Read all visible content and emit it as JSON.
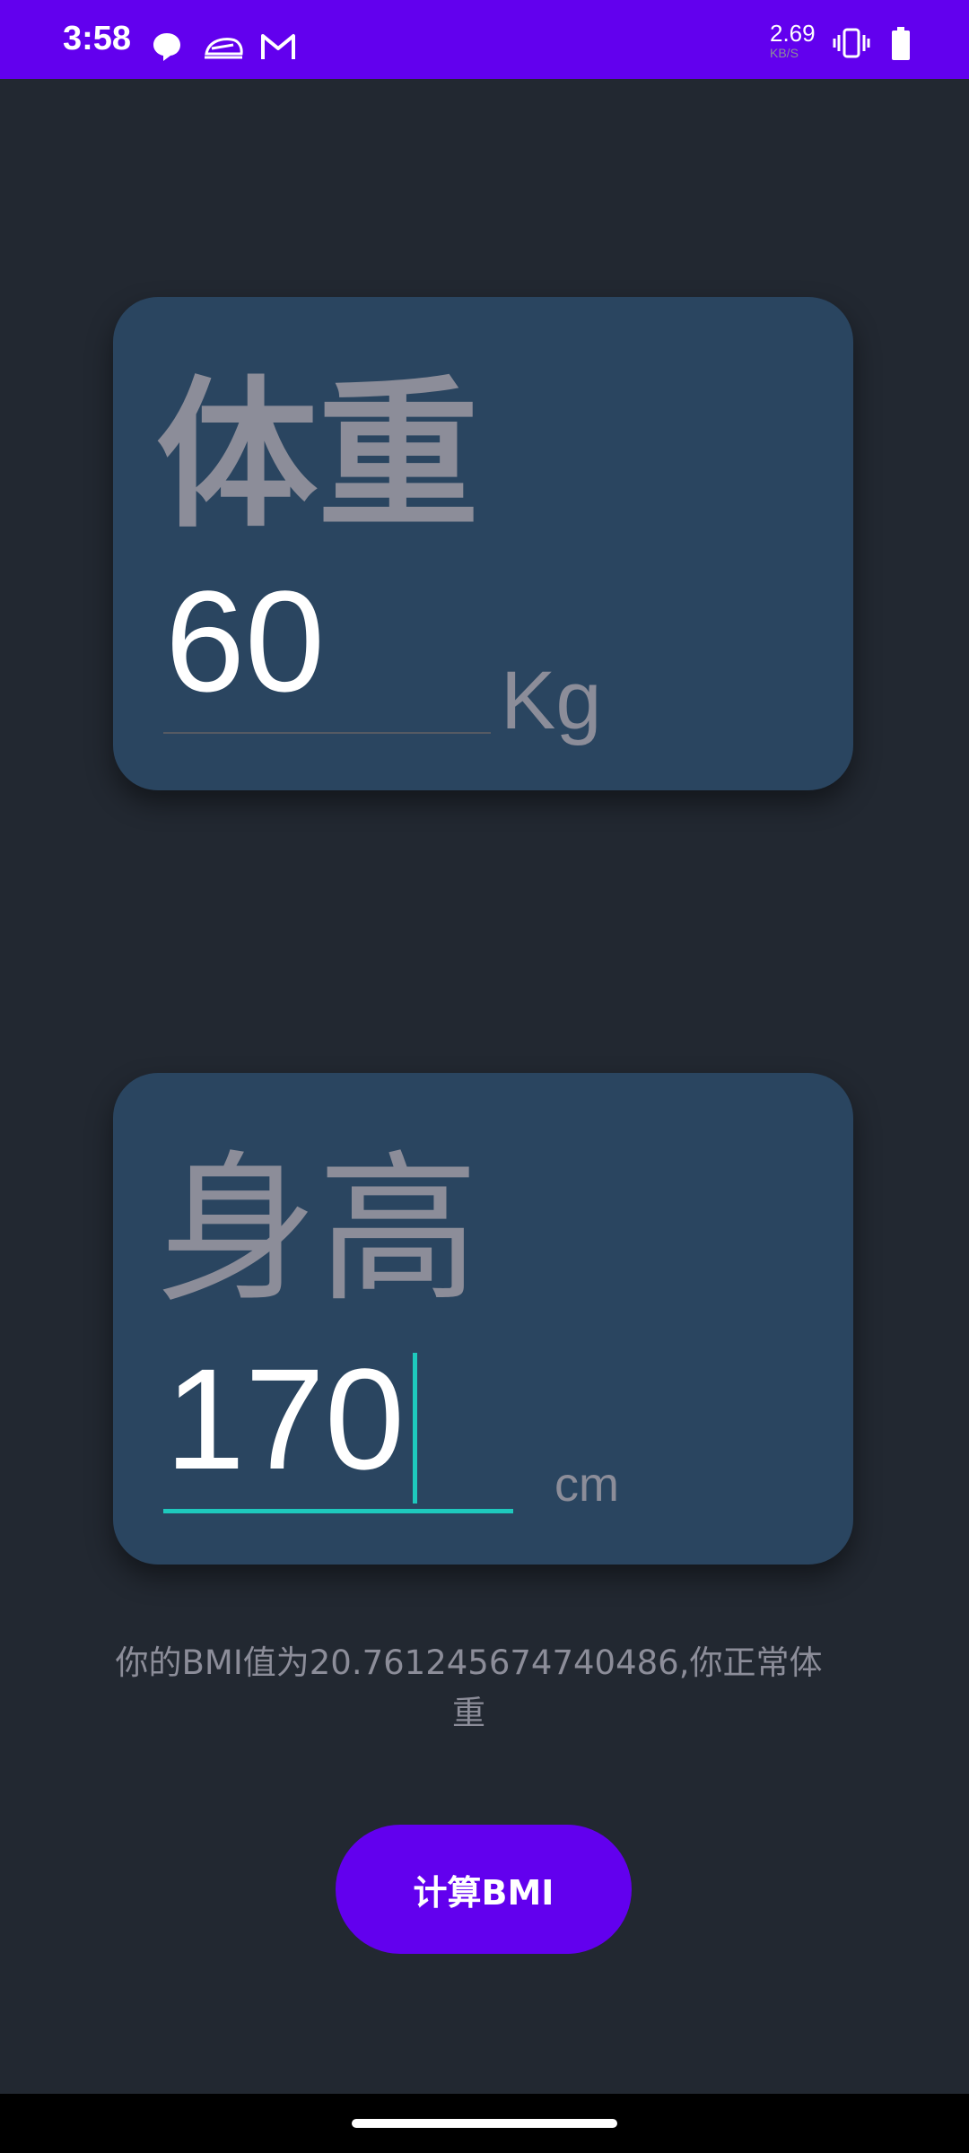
{
  "status_bar": {
    "time": "3:58",
    "net_speed_value": "2.69",
    "net_speed_unit": "KB/S",
    "notification_icons": [
      "chat-bubble-icon",
      "train-icon",
      "gmail-icon"
    ],
    "system_icons": [
      "vibrate-icon",
      "battery-icon"
    ]
  },
  "weight_card": {
    "label": "体重",
    "value": "60",
    "unit": "Kg"
  },
  "height_card": {
    "label": "身高",
    "value": "170",
    "unit": "cm"
  },
  "result": {
    "text": "你的BMI值为20.761245674740486,你正常体重"
  },
  "calculate_button": {
    "label": "计算BMI"
  },
  "colors": {
    "accent": "#6200ee",
    "background": "#222831",
    "card": "#2a4560",
    "input_focus": "#1ec9bd",
    "label_gray": "#8c8d99"
  }
}
